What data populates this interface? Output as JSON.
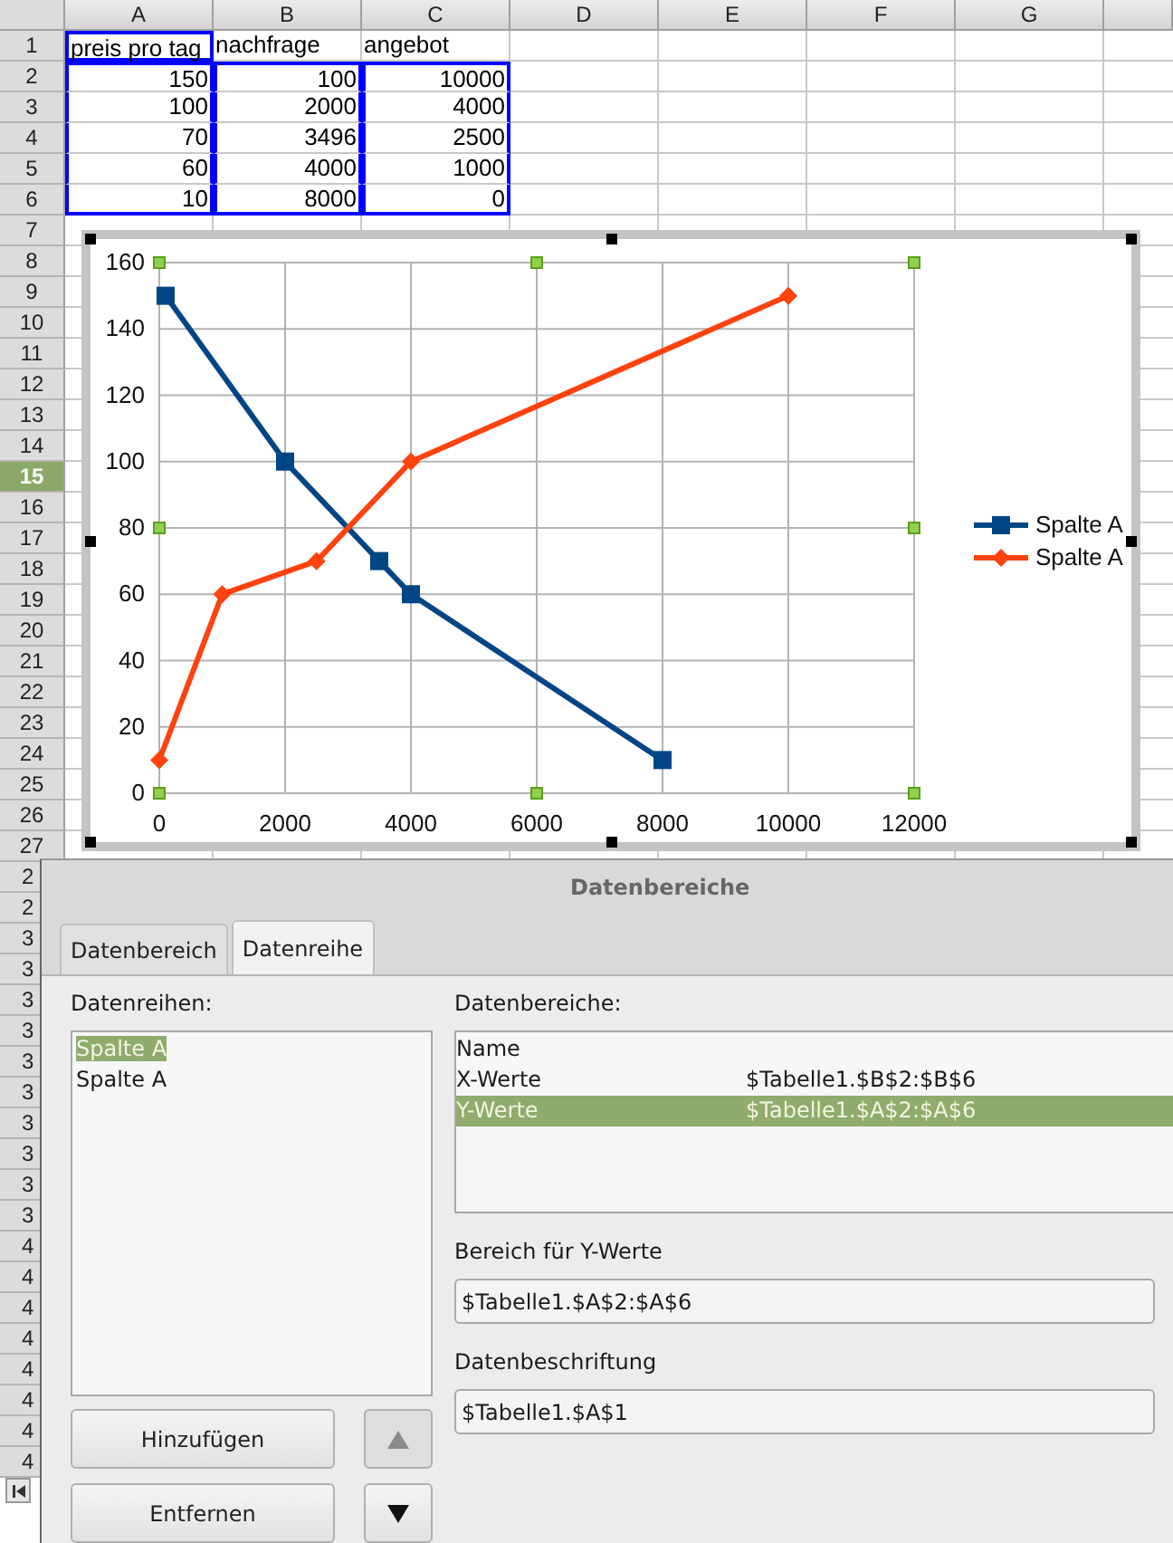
{
  "sheet": {
    "columns": [
      {
        "label": "A"
      },
      {
        "label": "B"
      },
      {
        "label": "C"
      },
      {
        "label": "D"
      },
      {
        "label": "E"
      },
      {
        "label": "F"
      },
      {
        "label": "G"
      }
    ],
    "rows": [
      {
        "label": "1",
        "selected": false,
        "cells": [
          {
            "value": "preis pro tag",
            "kind": "text",
            "highlighted": true
          },
          {
            "value": "nachfrage",
            "kind": "text",
            "highlighted": false
          },
          {
            "value": "angebot",
            "kind": "text",
            "highlighted": false
          }
        ]
      },
      {
        "label": "2",
        "selected": false,
        "cells": [
          {
            "value": "150",
            "kind": "number",
            "highlighted": true
          },
          {
            "value": "100",
            "kind": "number",
            "highlighted": true
          },
          {
            "value": "10000",
            "kind": "number",
            "highlighted": true
          }
        ]
      },
      {
        "label": "3",
        "selected": false,
        "cells": [
          {
            "value": "100",
            "kind": "number",
            "highlighted": true
          },
          {
            "value": "2000",
            "kind": "number",
            "highlighted": true
          },
          {
            "value": "4000",
            "kind": "number",
            "highlighted": true
          }
        ]
      },
      {
        "label": "4",
        "selected": false,
        "cells": [
          {
            "value": "70",
            "kind": "number",
            "highlighted": true
          },
          {
            "value": "3496",
            "kind": "number",
            "highlighted": true
          },
          {
            "value": "2500",
            "kind": "number",
            "highlighted": true
          }
        ]
      },
      {
        "label": "5",
        "selected": false,
        "cells": [
          {
            "value": "60",
            "kind": "number",
            "highlighted": true
          },
          {
            "value": "4000",
            "kind": "number",
            "highlighted": true
          },
          {
            "value": "1000",
            "kind": "number",
            "highlighted": true
          }
        ]
      },
      {
        "label": "6",
        "selected": false,
        "cells": [
          {
            "value": "10",
            "kind": "number",
            "highlighted": true
          },
          {
            "value": "8000",
            "kind": "number",
            "highlighted": true
          },
          {
            "value": "0",
            "kind": "number",
            "highlighted": true
          }
        ]
      },
      {
        "label": "7",
        "selected": false
      },
      {
        "label": "8",
        "selected": false
      },
      {
        "label": "9",
        "selected": false
      },
      {
        "label": "10",
        "selected": false
      },
      {
        "label": "11",
        "selected": false
      },
      {
        "label": "12",
        "selected": false
      },
      {
        "label": "13",
        "selected": false
      },
      {
        "label": "14",
        "selected": false
      },
      {
        "label": "15",
        "selected": true
      },
      {
        "label": "16",
        "selected": false
      },
      {
        "label": "17",
        "selected": false
      },
      {
        "label": "18",
        "selected": false
      },
      {
        "label": "19",
        "selected": false
      },
      {
        "label": "20",
        "selected": false
      },
      {
        "label": "21",
        "selected": false
      },
      {
        "label": "22",
        "selected": false
      },
      {
        "label": "23",
        "selected": false
      },
      {
        "label": "24",
        "selected": false
      },
      {
        "label": "25",
        "selected": false
      },
      {
        "label": "26",
        "selected": false
      },
      {
        "label": "27",
        "selected": false
      }
    ],
    "cut_row_labels": [
      "2",
      "2",
      "3",
      "3",
      "3",
      "3",
      "3",
      "3",
      "3",
      "3",
      "3",
      "3",
      "4",
      "4",
      "4",
      "4",
      "4",
      "4",
      "4",
      "4"
    ]
  },
  "chart": {
    "chart_data": {
      "type": "line",
      "grid": true,
      "xlim": [
        0,
        12000
      ],
      "ylim": [
        0,
        160
      ],
      "xticks": [
        0,
        2000,
        4000,
        6000,
        8000,
        10000,
        12000
      ],
      "yticks": [
        0,
        20,
        40,
        60,
        80,
        100,
        120,
        140,
        160
      ],
      "series": [
        {
          "name": "Spalte A",
          "color": "#004586",
          "marker": "square",
          "x": [
            100,
            2000,
            3496,
            4000,
            8000
          ],
          "values": [
            150,
            100,
            70,
            60,
            10
          ]
        },
        {
          "name": "Spalte A",
          "color": "#ff420e",
          "marker": "diamond",
          "x": [
            10000,
            4000,
            2500,
            1000,
            0
          ],
          "values": [
            150,
            100,
            70,
            60,
            10
          ]
        }
      ]
    }
  },
  "dialog": {
    "title": "Datenbereiche",
    "tabs": [
      {
        "label": "Datenbereich",
        "selected": false
      },
      {
        "label": "Datenreihe",
        "selected": true
      }
    ],
    "series_label": "Datenreihen:",
    "series": [
      {
        "label": "Spalte A",
        "selected": true
      },
      {
        "label": "Spalte A",
        "selected": false
      }
    ],
    "ranges_label": "Datenbereiche:",
    "ranges": [
      {
        "role": "Name",
        "selected": false
      },
      {
        "role": "X-Werte",
        "range": "$Tabelle1.$B$2:$B$6",
        "selected": false
      },
      {
        "role": "Y-Werte",
        "range": "$Tabelle1.$A$2:$A$6",
        "selected": true
      }
    ],
    "range_field": {
      "label": "Bereich für Y-Werte",
      "value": "$Tabelle1.$A$2:$A$6"
    },
    "label_field": {
      "label": "Datenbeschriftung",
      "value": "$Tabelle1.$A$1"
    },
    "buttons": [
      {
        "label": "Hinzufügen"
      },
      {
        "label": "Entfernen"
      }
    ],
    "move_up": {
      "disabled": true
    },
    "move_down": {
      "disabled": false
    }
  }
}
